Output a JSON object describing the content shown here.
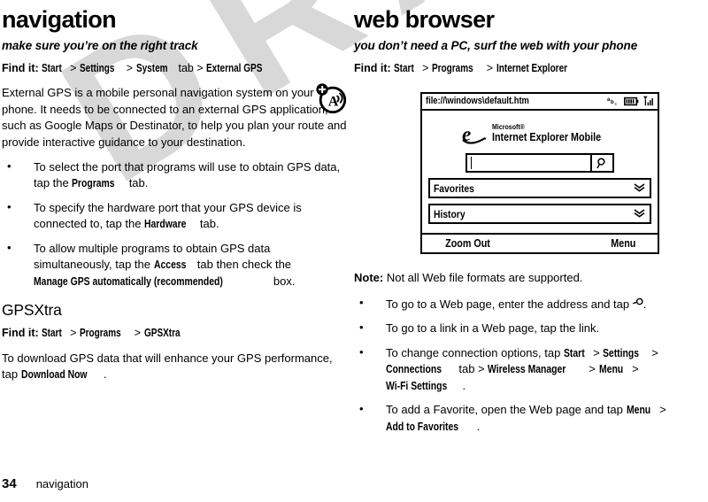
{
  "watermark": {
    "text": "DRAFT",
    "color": "#d8d8d8"
  },
  "footer": {
    "page_number": "34",
    "chapter": "navigation"
  },
  "left_column": {
    "title": "navigation",
    "tagline": "make sure you’re on the right track",
    "find_it": {
      "lead": "Find it:",
      "p1": "Start",
      "sep1": ">",
      "p2": "Settings",
      "sep2": ">",
      "p3": "System",
      "tab_word": "tab",
      "sep3": ">",
      "p4": "External GPS"
    },
    "intro": "External GPS is a mobile personal navigation system on your phone. It needs to be connected to an external GPS application, such as Google Maps or Destinator, to help you plan your route and provide interactive guidance to your destination.",
    "bullets": [
      {
        "a": "To select the port that programs will use to obtain GPS data, tap the ",
        "b": "Programs",
        "c": " tab."
      },
      {
        "a": "To specify the hardware port that your GPS device is connected to, tap the ",
        "b": "Hardware",
        "c": " tab."
      },
      {
        "a": "To allow multiple programs to obtain GPS data simultaneously, tap the ",
        "b": "Access",
        "c": " tab then check the ",
        "d": "Manage GPS automatically (recommended)",
        "e": " box."
      }
    ],
    "section2": {
      "heading": "GPSXtra",
      "find_it": {
        "lead": "Find it:",
        "p1": "Start",
        "sep1": ">",
        "p2": "Programs",
        "sep2": ">",
        "p3": "GPSXtra"
      },
      "body_a": "To download GPS data that will enhance your GPS performance, tap ",
      "body_b": "Download Now",
      "body_c": "."
    },
    "tty_icon": "hearing-aid-compatible-icon"
  },
  "right_column": {
    "title": "web browser",
    "tagline": "you don’t need a PC, surf the web with your phone",
    "find_it": {
      "lead": "Find it:",
      "p1": "Start",
      "sep1": ">",
      "p2": "Programs",
      "sep2": ">",
      "p3": "Internet Explorer"
    },
    "phone_mock": {
      "url": "file://\\windows\\default.htm",
      "status_icons": [
        "abc-input-icon",
        "battery-icon",
        "signal-icon"
      ],
      "logo": {
        "brand_small": "Microsoft®",
        "brand_main": "Internet Explorer Mobile",
        "mark": "internet-explorer-e-icon"
      },
      "address_input_value": "",
      "go_icon": "magnifier-icon",
      "rows": [
        {
          "label": "Favorites",
          "expander": "double-chevron-down-icon"
        },
        {
          "label": "History",
          "expander": "double-chevron-down-icon"
        }
      ],
      "softkey_left": "Zoom Out",
      "softkey_right": "Menu"
    },
    "note": {
      "label": "Note:",
      "text": " Not all Web file formats are supported."
    },
    "bullets": [
      {
        "a": "To go to a Web page, enter the address and tap ",
        "icon": "magnifier-icon",
        "c": "."
      },
      {
        "a": "To go to a link in a Web page, tap the link."
      },
      {
        "a": "To change connection options, tap ",
        "b": "Start",
        "s1": " > ",
        "b2": "Settings",
        "s2": " > ",
        "b3": "Connections",
        "tabword": " tab > ",
        "b4": "Wireless Manager",
        "s3": " > ",
        "b5": "Menu",
        "s4": " > ",
        "b6": "Wi-Fi Settings",
        "end": "."
      },
      {
        "a": "To add a Favorite, open the Web page and tap ",
        "b": "Menu",
        "s1": " > ",
        "b2": "Add to Favorites",
        "end": "."
      }
    ]
  }
}
